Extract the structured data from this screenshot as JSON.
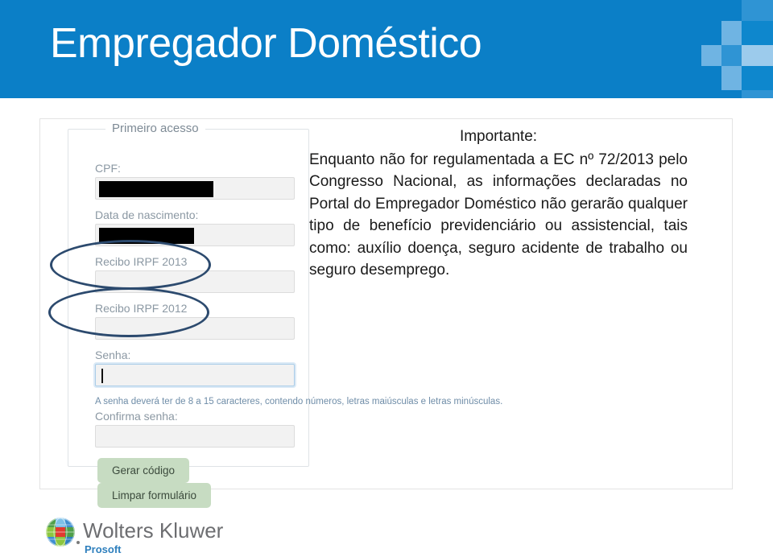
{
  "header": {
    "title": "Empregador Doméstico",
    "background_color": "#0b7fc7",
    "decoration_icon": "checkerboard-squares-icon"
  },
  "panel": {
    "fieldset_legend": "Primeiro acesso",
    "fields": [
      {
        "label": "CPF:",
        "value": "",
        "redacted": true,
        "redaction_width": 142,
        "focused": false
      },
      {
        "label": "Data de nascimento:",
        "value": "",
        "redacted": true,
        "redaction_width": 118,
        "focused": false
      },
      {
        "label": "Recibo IRPF 2013",
        "value": "",
        "redacted": false,
        "focused": false,
        "annotated": true
      },
      {
        "label": "Recibo IRPF 2012",
        "value": "",
        "redacted": false,
        "focused": false,
        "annotated": true
      },
      {
        "label": "Senha:",
        "value": "",
        "redacted": false,
        "focused": true
      },
      {
        "label": "Confirma senha:",
        "value": "",
        "redacted": false,
        "focused": false
      }
    ],
    "password_help": "A senha deverá ter de 8 a 15 caracteres, contendo números, letras maiúsculas e letras minúsculas.",
    "buttons": [
      {
        "label": "Gerar código"
      },
      {
        "label": "Limpar formulário"
      }
    ],
    "button_color": "#c7dcc2",
    "annotation_color": "#2c4a6e"
  },
  "overlay": {
    "heading": "Importante:",
    "body": "Enquanto não for regulamentada a EC nº 72/2013 pelo Congresso Nacional, as informações declaradas no Portal do Empregador Doméstico não gerarão qualquer tipo de benefício previdenciário ou assistencial, tais como: auxílio doença, seguro acidente de trabalho ou seguro desemprego."
  },
  "footer": {
    "brand": "Wolters Kluwer",
    "sub_brand": "Prosoft",
    "logo_icon": "wolters-kluwer-globe-icon",
    "brand_color": "#6d6e71",
    "sub_brand_color": "#2e7fbd"
  }
}
